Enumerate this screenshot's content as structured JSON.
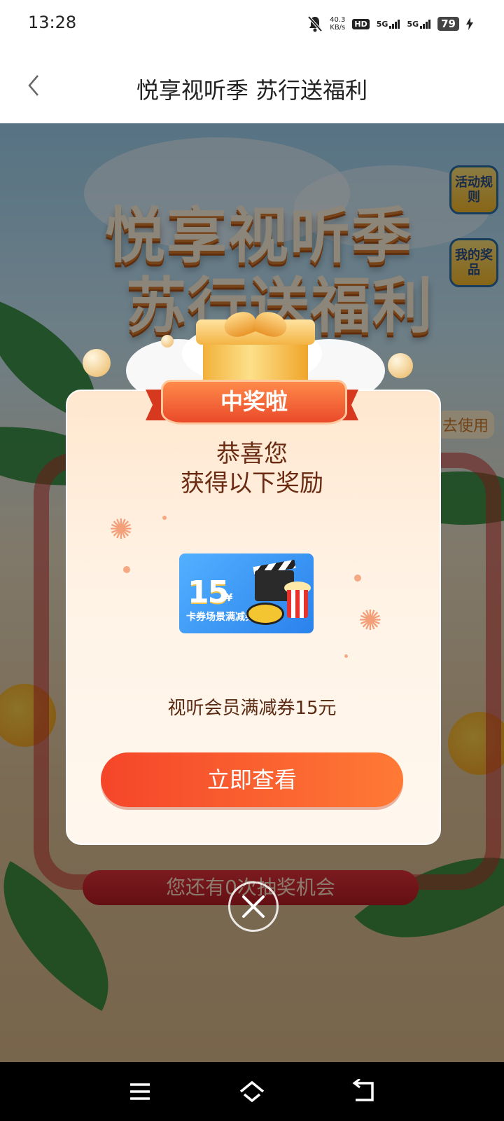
{
  "status_bar": {
    "time": "13:28",
    "net_speed_value": "40.3",
    "net_speed_unit": "KB/s",
    "hd_label": "HD",
    "sim1_label": "5G",
    "sim2_label": "5G",
    "battery": "79"
  },
  "nav": {
    "title": "悦享视听季 苏行送福利"
  },
  "background": {
    "title_line1": "悦享视听季",
    "title_line2": "苏行送福利",
    "rules_button": "活动规则",
    "my_prizes_button": "我的奖品",
    "go_use_label": "去使用",
    "chances_text": "您还有0次抽奖机会"
  },
  "popup": {
    "ribbon_label": "中奖啦",
    "congrats_line1": "恭喜您",
    "congrats_line2": "获得以下奖励",
    "coupon": {
      "amount": "15",
      "currency": "¥",
      "name": "卡券场景满减券"
    },
    "prize_name": "视听会员满减券15元",
    "cta_label": "立即查看"
  },
  "icons": {
    "back": "chevron-left-icon",
    "close": "close-circle-icon",
    "mute": "bell-muted-icon",
    "menu": "menu-icon",
    "home": "home-icon",
    "return": "back-icon"
  },
  "colors": {
    "cta_start": "#f5452a",
    "cta_end": "#ff7a35",
    "popup_bg": "#fff3e6",
    "congrats_text": "#6b2a12"
  }
}
